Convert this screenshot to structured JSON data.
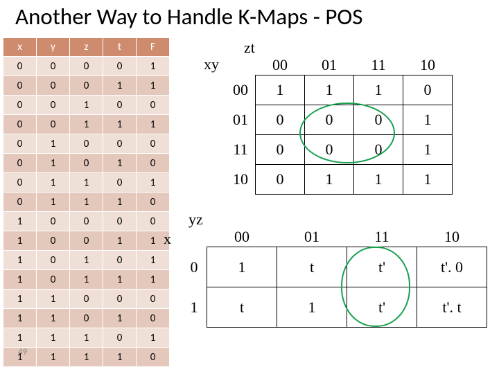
{
  "title": "Another Way to Handle K-Maps - POS",
  "slidenum": "49",
  "truth_table": {
    "headers": [
      "x",
      "y",
      "z",
      "t",
      "F"
    ],
    "rows": [
      [
        "0",
        "0",
        "0",
        "0",
        "1"
      ],
      [
        "0",
        "0",
        "0",
        "1",
        "1"
      ],
      [
        "0",
        "0",
        "1",
        "0",
        "0"
      ],
      [
        "0",
        "0",
        "1",
        "1",
        "1"
      ],
      [
        "0",
        "1",
        "0",
        "0",
        "0"
      ],
      [
        "0",
        "1",
        "0",
        "1",
        "0"
      ],
      [
        "0",
        "1",
        "1",
        "0",
        "1"
      ],
      [
        "0",
        "1",
        "1",
        "1",
        "0"
      ],
      [
        "1",
        "0",
        "0",
        "0",
        "0"
      ],
      [
        "1",
        "0",
        "0",
        "1",
        "1"
      ],
      [
        "1",
        "0",
        "1",
        "0",
        "1"
      ],
      [
        "1",
        "0",
        "1",
        "1",
        "1"
      ],
      [
        "1",
        "1",
        "0",
        "0",
        "0"
      ],
      [
        "1",
        "1",
        "0",
        "1",
        "0"
      ],
      [
        "1",
        "1",
        "1",
        "0",
        "1"
      ],
      [
        "1",
        "1",
        "1",
        "1",
        "0"
      ]
    ]
  },
  "kmap1": {
    "top_axis": "zt",
    "left_axis": "xy",
    "col_labels": [
      "00",
      "01",
      "11",
      "10"
    ],
    "row_labels": [
      "00",
      "01",
      "11",
      "10"
    ],
    "cells": [
      [
        "1",
        "1",
        "1",
        "0"
      ],
      [
        "0",
        "0",
        "0",
        "1"
      ],
      [
        "0",
        "0",
        "0",
        "1"
      ],
      [
        "0",
        "1",
        "1",
        "1"
      ]
    ]
  },
  "kmap2": {
    "top_axis": "yz",
    "left_axis": "x",
    "col_labels": [
      "00",
      "01",
      "11",
      "10"
    ],
    "row_labels": [
      "0",
      "1"
    ],
    "cells": [
      [
        "1",
        "t",
        "t'",
        "t'. 0"
      ],
      [
        "t",
        "1",
        "t'",
        "t'. t"
      ]
    ]
  }
}
